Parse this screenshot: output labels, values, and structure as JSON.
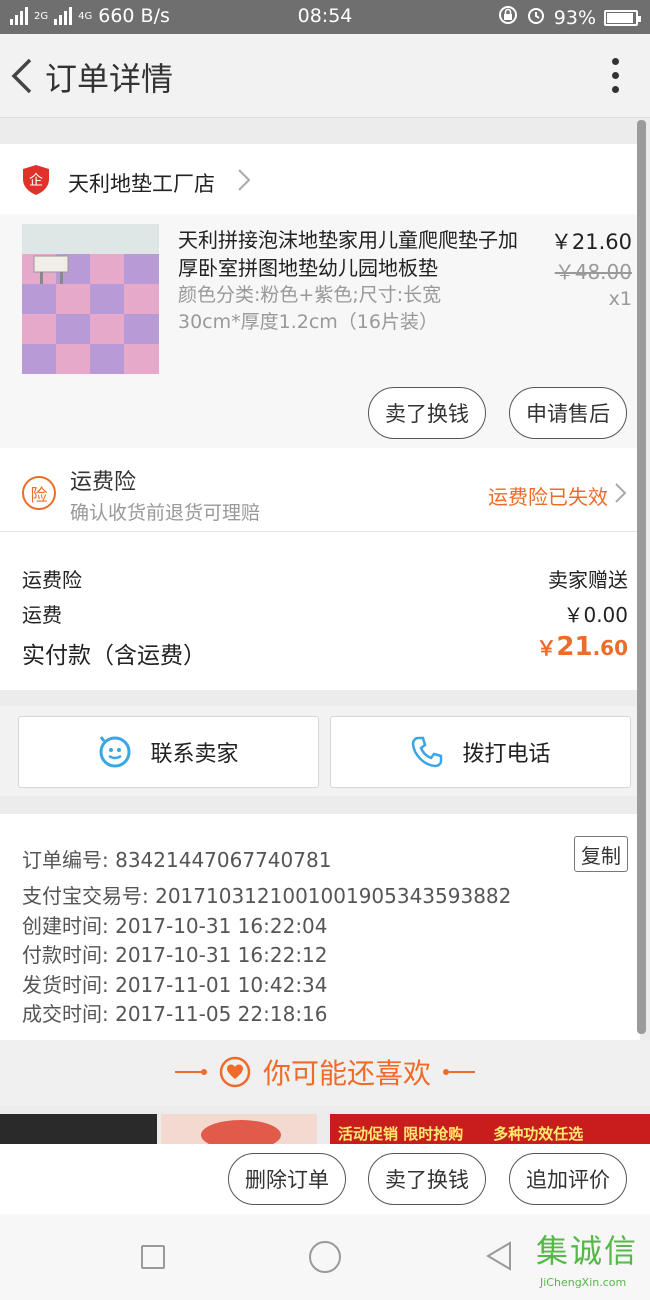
{
  "status_bar": {
    "signal_left": "2G",
    "signal_right": "4G",
    "net_speed": "660 B/s",
    "time": "08:54",
    "battery": "93%"
  },
  "header": {
    "title": "订单详情"
  },
  "shop": {
    "name": "天利地垫工厂店"
  },
  "item": {
    "title": "天利拼接泡沫地垫家用儿童爬爬垫子加厚卧室拼图地垫幼儿园地板垫",
    "spec": "颜色分类:粉色+紫色;尺寸:长宽30cm*厚度1.2cm（16片装）",
    "price": "￥21.60",
    "original_price": "￥48.00",
    "quantity": "x1",
    "sell_button": "卖了换钱",
    "aftersale_button": "申请售后"
  },
  "insurance": {
    "badge": "险",
    "title": "运费险",
    "subtitle": "确认收货前退货可理赔",
    "status": "运费险已失效"
  },
  "fees": {
    "insurance_label": "运费险",
    "insurance_value": "卖家赠送",
    "shipping_label": "运费",
    "shipping_value": "￥0.00",
    "total_label": "实付款（含运费）",
    "total_currency": "￥",
    "total_int": "21",
    "total_dec": ".60"
  },
  "contact": {
    "seller_button": "联系卖家",
    "call_button": "拨打电话"
  },
  "order_info": {
    "order_no": "订单编号: 83421447067740781",
    "copy_button": "复制",
    "alipay_no": "支付宝交易号: 2017103121001001905343593882",
    "created": "创建时间: 2017-10-31 16:22:04",
    "paid": "付款时间: 2017-10-31 16:22:12",
    "shipped": "发货时间: 2017-11-01 10:42:34",
    "completed": "成交时间: 2017-11-05 22:18:16"
  },
  "recommend": {
    "title": "你可能还喜欢",
    "banner_text_1": "活动促销 限时抢购",
    "banner_text_2": "多种功效任选"
  },
  "bottom_actions": {
    "delete_button": "删除订单",
    "sell_button": "卖了换钱",
    "review_button": "追加评价"
  },
  "watermark": {
    "glyphs": "集诚信",
    "site": "JiChengXin.com"
  },
  "colors": {
    "accent": "#ef6b2a",
    "shop_icon": "#e0312a",
    "contact_icon": "#3aa6e6"
  }
}
